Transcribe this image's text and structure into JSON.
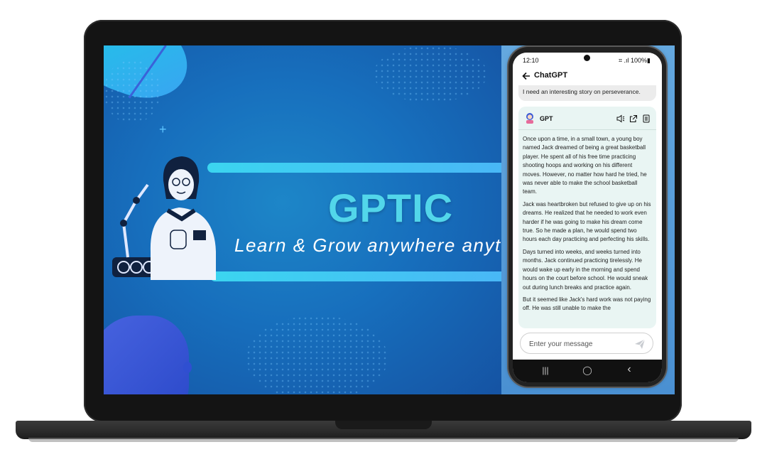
{
  "banner": {
    "brand": "GPTIC",
    "tagline": "Learn & Grow anywhere anyti"
  },
  "phone": {
    "status": {
      "time": "12:10",
      "indicators": "⌗ .ıl 100%▮"
    },
    "app_bar": {
      "back_icon": "arrow-left-icon",
      "title": "ChatGPT"
    },
    "user_message": "I need an interesting story on perseverance.",
    "reply": {
      "sender": "GPT",
      "icons": [
        "speaker-icon",
        "share-icon",
        "copy-icon"
      ],
      "paragraphs": [
        "Once upon a time, in a small town, a young boy named Jack dreamed of being a great basketball player. He spent all of his free time practicing shooting hoops and working on his different moves. However, no matter how hard he tried, he was never able to make the school basketball team.",
        "Jack was heartbroken but refused to give up on his dreams. He realized that he needed to work even harder if he was going to make his dream come true. So he made a plan, he would spend two hours each day practicing and perfecting his skills.",
        "Days turned into weeks, and weeks turned into months. Jack continued practicing tirelessly. He would wake up early in the morning and spend hours on the court before school. He would sneak out during lunch breaks and practice again.",
        "But it seemed like Jack's hard work was not paying off. He was still unable to make the"
      ]
    },
    "input": {
      "placeholder": "Enter your message",
      "value": ""
    },
    "nav": {
      "recent": "|||",
      "home": "◯",
      "back": "‹"
    }
  },
  "colors": {
    "banner_bg": "#176fbd",
    "brand_text": "#52d6ea",
    "accent_bar": "#3bd5f0",
    "reply_bg": "#e9f5f3"
  }
}
